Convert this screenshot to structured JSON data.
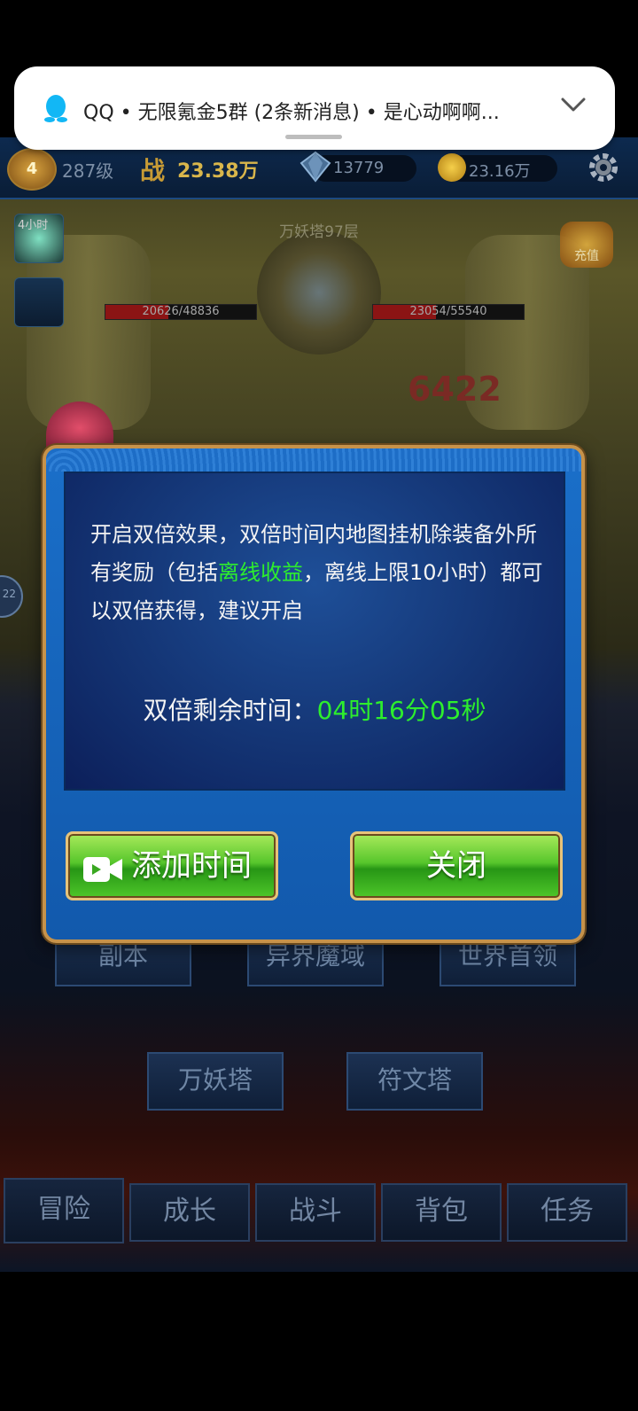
{
  "notification": {
    "app": "QQ",
    "text": "QQ  •  无限氪金5群 (2条新消息)  •  是心动啊啊..."
  },
  "hud": {
    "rank_badge": "4",
    "level": "287级",
    "power_label": "战",
    "power_value": "23.38万",
    "diamonds": "13779",
    "gold": "23.16万"
  },
  "scene": {
    "title": "万妖塔97层",
    "buff_timer": "4小时",
    "hp_left": "20626/48836",
    "hp_left_ratio": 0.42,
    "hp_right": "23054/55540",
    "hp_right_ratio": 0.42,
    "damage_number": "6422",
    "shop_label": "充值",
    "side_number": "22"
  },
  "menu": {
    "row1": [
      "副本",
      "异界魔域",
      "世界首领"
    ],
    "row2": [
      "万妖塔",
      "符文塔"
    ]
  },
  "tabs": [
    "冒险",
    "成长",
    "战斗",
    "背包",
    "任务"
  ],
  "dialog": {
    "desc_part1": "开启双倍效果，双倍时间内地图挂机除装备外所有奖励（包括",
    "desc_highlight": "离线收益",
    "desc_part2": "，离线上限10小时）都可以双倍获得，建议开启",
    "timer_label": "双倍剩余时间：",
    "timer_value": "04时16分05秒",
    "add_time_button": "添加时间",
    "close_button": "关闭"
  },
  "colors": {
    "highlight_green": "#2dee2d",
    "dialog_blue": "#1a6fc9",
    "button_green": "#57c62c",
    "gold_border": "#c6924a"
  }
}
